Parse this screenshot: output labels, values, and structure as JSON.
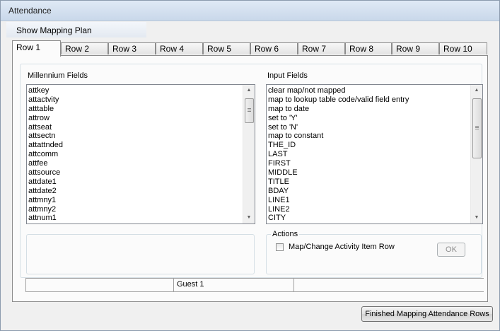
{
  "window": {
    "title": "Attendance"
  },
  "menu": {
    "items": [
      "Show Mapping Plan"
    ]
  },
  "tabs": [
    "Row 1",
    "Row 2",
    "Row 3",
    "Row 4",
    "Row 5",
    "Row 6",
    "Row 7",
    "Row 8",
    "Row 9",
    "Row 10"
  ],
  "active_tab": "Row 1",
  "millennium_fields": {
    "label": "Millennium Fields",
    "items": [
      "attkey",
      "attactvity",
      "atttable",
      "attrow",
      "attseat",
      "attsectn",
      "attattnded",
      "attcomm",
      "attfee",
      "attsource",
      "attdate1",
      "attdate2",
      "attmny1",
      "attmny2",
      "attnum1"
    ]
  },
  "input_fields": {
    "label": "Input Fields",
    "items": [
      "clear map/not mapped",
      "map to lookup table code/valid field entry",
      "map to date",
      "set to 'Y'",
      "set to 'N'",
      "map to constant",
      "THE_ID",
      "LAST",
      "FIRST",
      "MIDDLE",
      "TITLE",
      "BDAY",
      "LINE1",
      "LINE2",
      "CITY"
    ]
  },
  "actions": {
    "legend": "Actions",
    "checkbox_label": "Map/Change Activity Item Row",
    "checked": false,
    "ok_label": "OK",
    "ok_enabled": false
  },
  "status": {
    "cells": [
      "",
      "Guest 1",
      ""
    ]
  },
  "footer": {
    "finish_label": "Finished Mapping Attendance Rows"
  },
  "icons": {
    "scroll_up": "scroll-up-arrow-icon",
    "scroll_down": "scroll-down-arrow-icon",
    "thumb_grip": "scroll-grip-icon"
  }
}
